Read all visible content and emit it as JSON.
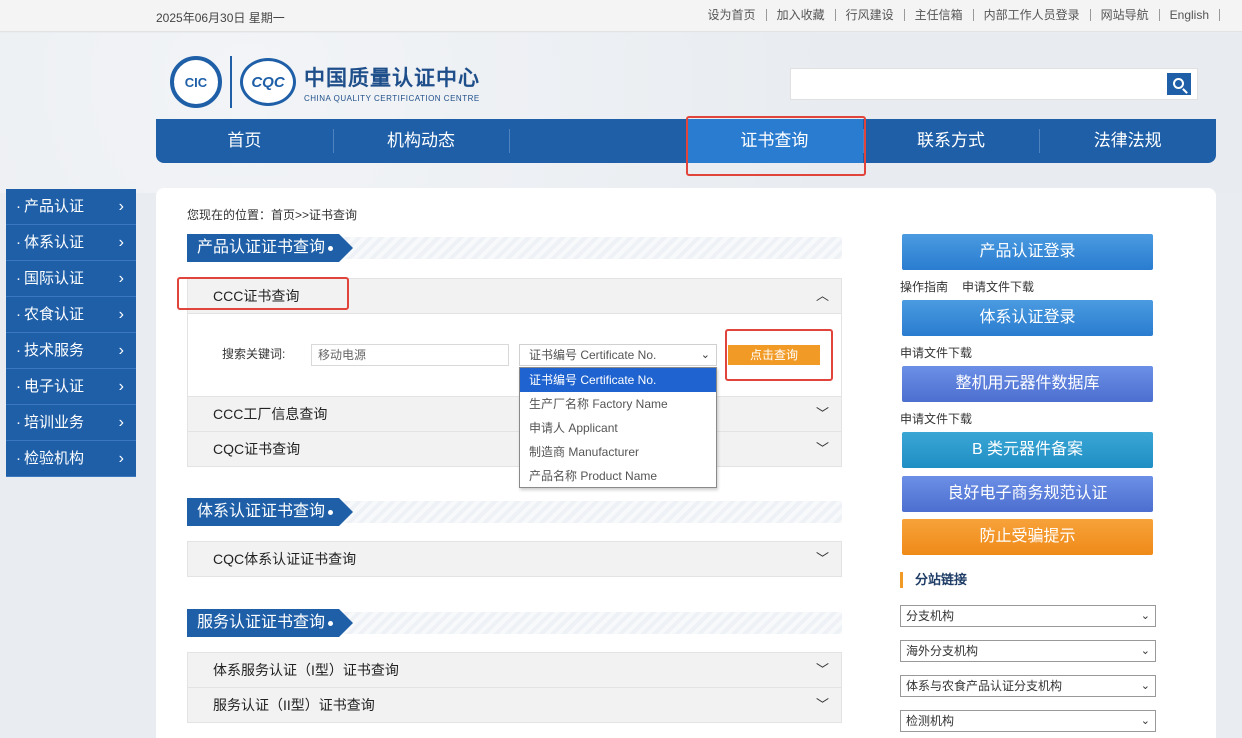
{
  "topbar": {
    "date": "2025年06月30日  星期一",
    "links": [
      "设为首页",
      "加入收藏",
      "行风建设",
      "主任信箱",
      "内部工作人员登录",
      "网站导航",
      "English"
    ]
  },
  "logo": {
    "circle1": "CIC",
    "circle2": "CQC",
    "name_cn": "中国质量认证中心",
    "name_en": "CHINA QUALITY CERTIFICATION CENTRE"
  },
  "nav": {
    "items": [
      "首页",
      "机构动态",
      "",
      "证书查询",
      "联系方式",
      "法律法规"
    ],
    "active_index": 3
  },
  "sidebar": {
    "items": [
      "产品认证",
      "体系认证",
      "国际认证",
      "农食认证",
      "技术服务",
      "电子认证",
      "培训业务",
      "检验机构"
    ]
  },
  "breadcrumb": "您现在的位置：首页>>证书查询",
  "sections": {
    "product": {
      "title": "产品认证证书查询",
      "accordions": [
        "CCC证书查询",
        "CCC工厂信息查询",
        "CQC证书查询"
      ]
    },
    "system": {
      "title": "体系认证证书查询",
      "accordions": [
        "CQC体系认证证书查询"
      ]
    },
    "service": {
      "title": "服务认证证书查询",
      "accordions": [
        "体系服务认证（I型）证书查询",
        "服务认证（II型）证书查询"
      ]
    }
  },
  "search_form": {
    "keyword_label": "搜索关键词:",
    "keyword_value": "移动电源",
    "select_value": "证书编号 Certificate No.",
    "button_label": "点击查询",
    "options": [
      "证书编号 Certificate No.",
      "生产厂名称 Factory Name",
      "申请人 Applicant",
      "制造商 Manufacturer",
      "产品名称 Product Name"
    ],
    "highlighted_option": 0
  },
  "right_panel": {
    "buttons": [
      "产品认证登录",
      "体系认证登录",
      "整机用元器件数据库",
      "B 类元器件备案",
      "良好电子商务规范认证",
      "防止受骗提示"
    ],
    "links1": [
      "操作指南",
      "申请文件下载"
    ],
    "links2": [
      "申请文件下载"
    ],
    "links3": [
      "申请文件下载"
    ],
    "branch_title": "分站链接",
    "branch_selects": [
      "分支机构",
      "海外分支机构",
      "体系与农食产品认证分支机构",
      "检测机构"
    ]
  },
  "icons": {
    "nav_chevron": "chevron-right-icon",
    "accordion_up": "chevron-up-icon",
    "accordion_down": "chevron-down-icon",
    "search": "search-icon"
  },
  "colors": {
    "brand_blue": "#1e5fa8",
    "accent_orange": "#f19a25",
    "highlight_red": "#e0443a"
  }
}
